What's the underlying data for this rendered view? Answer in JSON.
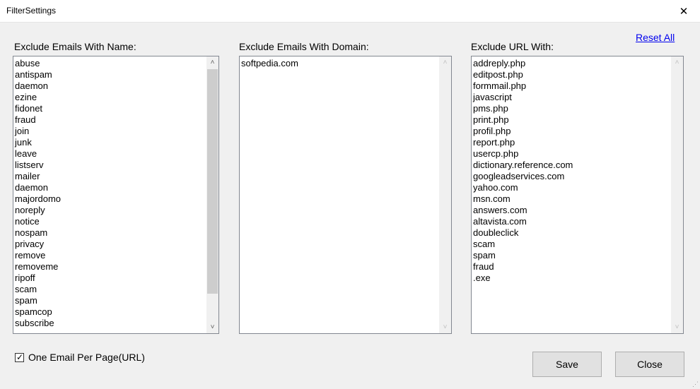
{
  "window": {
    "title": "FilterSettings",
    "close_glyph": "✕"
  },
  "reset_all": "Reset All",
  "panels": {
    "names": {
      "label": "Exclude Emails With Name:",
      "items": [
        "abuse",
        "antispam",
        "daemon",
        "ezine",
        "fidonet",
        "fraud",
        "join",
        "junk",
        "leave",
        "listserv",
        "mailer",
        "daemon",
        "majordomo",
        "noreply",
        "notice",
        "nospam",
        "privacy",
        "remove",
        "removeme",
        "ripoff",
        "scam",
        "spam",
        "spamcop",
        "subscribe"
      ]
    },
    "domains": {
      "label": "Exclude Emails With Domain:",
      "items": [
        "softpedia.com"
      ]
    },
    "urls": {
      "label": "Exclude URL With:",
      "items": [
        "addreply.php",
        "editpost.php",
        "formmail.php",
        "javascript",
        "pms.php",
        "print.php",
        "profil.php",
        "report.php",
        "usercp.php",
        "dictionary.reference.com",
        "googleadservices.com",
        "yahoo.com",
        "msn.com",
        "answers.com",
        "altavista.com",
        "doubleclick",
        "scam",
        "spam",
        "fraud",
        ".exe"
      ]
    }
  },
  "option": {
    "label": "One Email Per Page(URL)",
    "checked": true,
    "check_glyph": "✓"
  },
  "buttons": {
    "save": "Save",
    "close": "Close"
  },
  "icons": {
    "scroll_up": "chevron-up-icon",
    "scroll_down": "chevron-down-icon"
  }
}
